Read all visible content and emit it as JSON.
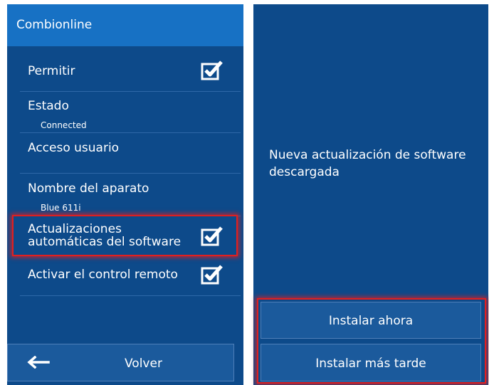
{
  "left_panel": {
    "title": "Combionline",
    "rows": [
      {
        "label": "Permitir",
        "checked": true
      },
      {
        "label": "Estado",
        "sub": "Connected"
      },
      {
        "label": "Acceso usuario"
      },
      {
        "label": "Nombre del aparato",
        "sub": "Blue 611i"
      },
      {
        "label_line1": "Actualizaciones",
        "label_line2": "automáticas del software",
        "checked": true,
        "highlighted": true
      },
      {
        "label": "Activar el control remoto",
        "checked": true
      }
    ],
    "back_button": {
      "label": "Volver",
      "icon": "arrow-left-icon"
    }
  },
  "right_panel": {
    "message_line1": "Nueva actualización de software",
    "message_line2": "descargada",
    "install_now_label": "Instalar ahora",
    "install_later_label": "Instalar más tarde",
    "buttons_highlighted": true
  },
  "colors": {
    "panel_bg": "#0d4a8a",
    "header_bg": "#1771c4",
    "button_bg": "#1b5a9c",
    "highlight": "#e02020"
  }
}
